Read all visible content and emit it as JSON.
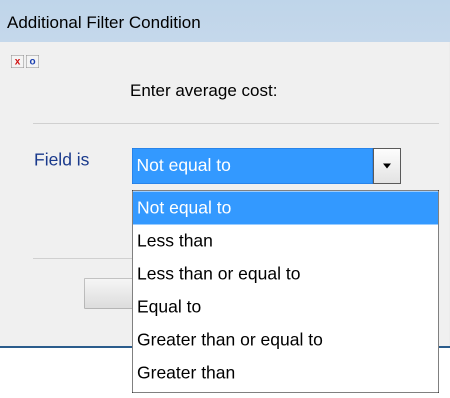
{
  "window": {
    "title": "Additional Filter Condition"
  },
  "dialog": {
    "close_icon": "close-icon",
    "options_icon": "options-icon",
    "prompt": "Enter average cost:",
    "field_label": "Field is"
  },
  "combo": {
    "selected_value": "Not equal to",
    "options": [
      "Not equal to",
      "Less than",
      "Less than or equal to",
      "Equal to",
      "Greater than or equal to",
      "Greater than"
    ],
    "highlighted_index": 0
  },
  "colors": {
    "selection": "#3399ff",
    "titlebar": "#c5d8eb",
    "label": "#1a3a8c"
  }
}
